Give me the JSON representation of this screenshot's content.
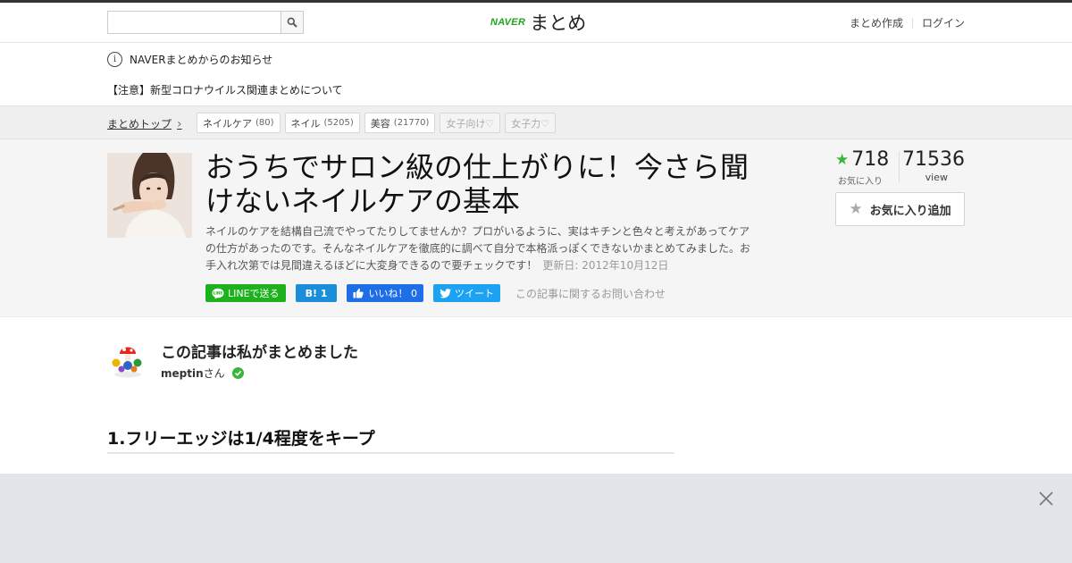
{
  "header": {
    "search": {
      "placeholder": "",
      "value": ""
    },
    "logo": {
      "brand": "NAVER",
      "product": "まとめ"
    },
    "links": {
      "create": "まとめ作成",
      "login": "ログイン"
    }
  },
  "notice": {
    "heading": "NAVERまとめからのお知らせ",
    "link": "【注意】新型コロナウイルス関連まとめについて"
  },
  "tagbar": {
    "breadcrumb": "まとめトップ",
    "tags": [
      {
        "label": "ネイルケア",
        "count": "(80)",
        "faded": false
      },
      {
        "label": "ネイル",
        "count": "(5205)",
        "faded": false
      },
      {
        "label": "美容",
        "count": "(21770)",
        "faded": false
      },
      {
        "label": "女子向け♡",
        "count": "",
        "faded": true
      },
      {
        "label": "女子力♡",
        "count": "",
        "faded": true
      }
    ]
  },
  "article": {
    "title": "おうちでサロン級の仕上がりに！今さら聞けないネイルケアの基本",
    "description": "ネイルのケアを結構自己流でやってたりしてませんか？プロがいるように、実はキチンと色々と考えがあってケアの仕方があったのです。そんなネイルケアを徹底的に調べて自分で本格派っぽくできないかまとめてみました。お手入れ次第では見間違えるほどに大変身できるので要チェックです！",
    "updated": "更新日: 2012年10月12日",
    "favorites": "718",
    "favorites_label": "お気に入り",
    "views": "71536",
    "views_label": "view",
    "fav_add_label": "お気に入り追加"
  },
  "share": {
    "line": "LINEで送る",
    "hatena": "B! 1",
    "facebook": "いいね！ 0",
    "twitter": "ツイート",
    "inquiry": "この記事に関するお問い合わせ"
  },
  "author": {
    "title": "この記事は私がまとめました",
    "name": "meptin",
    "suffix": "さん"
  },
  "section": {
    "heading": "1.フリーエッジは1/4程度をキープ"
  },
  "colors": {
    "brand_green": "#1ea51e",
    "star_green": "#3bb43b",
    "banner_bg": "#e2e5e9"
  }
}
